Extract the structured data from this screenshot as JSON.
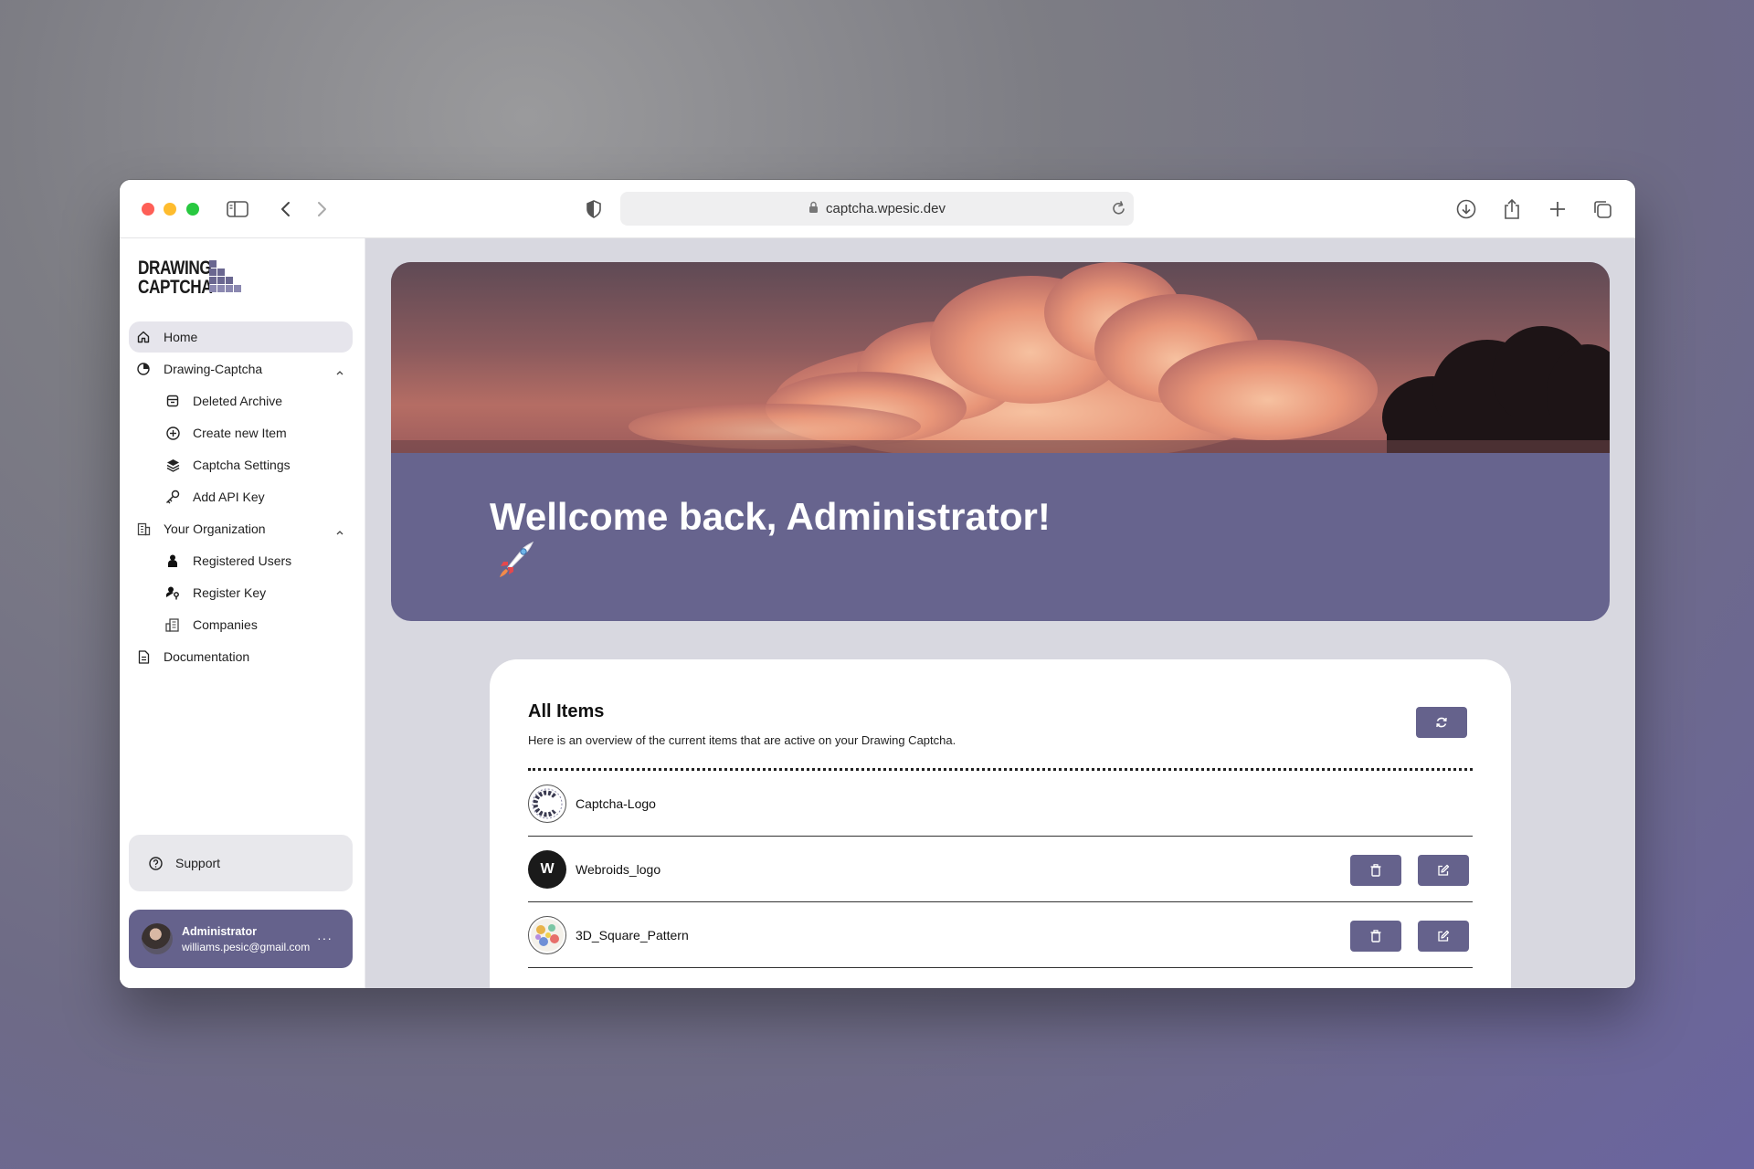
{
  "browser": {
    "url": "captcha.wpesic.dev"
  },
  "sidebar": {
    "logo_line1": "DRAWING",
    "logo_line2": "CAPTCHA",
    "items": [
      {
        "label": "Home",
        "icon": "home-icon",
        "active": true
      },
      {
        "label": "Drawing-Captcha",
        "icon": "clock-icon",
        "expanded": true
      },
      {
        "label": "Deleted Archive",
        "icon": "archive-icon",
        "sub": true
      },
      {
        "label": "Create new Item",
        "icon": "plus-circle-icon",
        "sub": true
      },
      {
        "label": "Captcha Settings",
        "icon": "layers-icon",
        "sub": true
      },
      {
        "label": "Add API Key",
        "icon": "key-icon",
        "sub": true
      },
      {
        "label": "Your Organization",
        "icon": "building-icon",
        "expanded": true
      },
      {
        "label": "Registered Users",
        "icon": "user-icon",
        "sub": true
      },
      {
        "label": "Register Key",
        "icon": "key-register-icon",
        "sub": true
      },
      {
        "label": "Companies",
        "icon": "companies-icon",
        "sub": true
      },
      {
        "label": "Documentation",
        "icon": "document-icon"
      }
    ],
    "support_label": "Support",
    "user": {
      "name": "Administrator",
      "email": "williams.pesic@gmail.com",
      "more": "···"
    }
  },
  "hero": {
    "title": "Wellcome back, Administrator!",
    "emoji": "rocket-icon"
  },
  "items_card": {
    "title": "All Items",
    "description": "Here is an overview of the current items that are active on your Drawing Captcha.",
    "rows": [
      {
        "name": "Captcha-Logo",
        "thumb": "captcha-logo-thumb",
        "actions": false
      },
      {
        "name": "Webroids_logo",
        "thumb_letter": "W",
        "actions": true
      },
      {
        "name": "3D_Square_Pattern",
        "thumb": "pattern-thumb",
        "actions": true
      }
    ]
  },
  "colors": {
    "accent": "#65628c",
    "hero_bg": "#67648e",
    "main_bg": "#d8d8e0"
  }
}
